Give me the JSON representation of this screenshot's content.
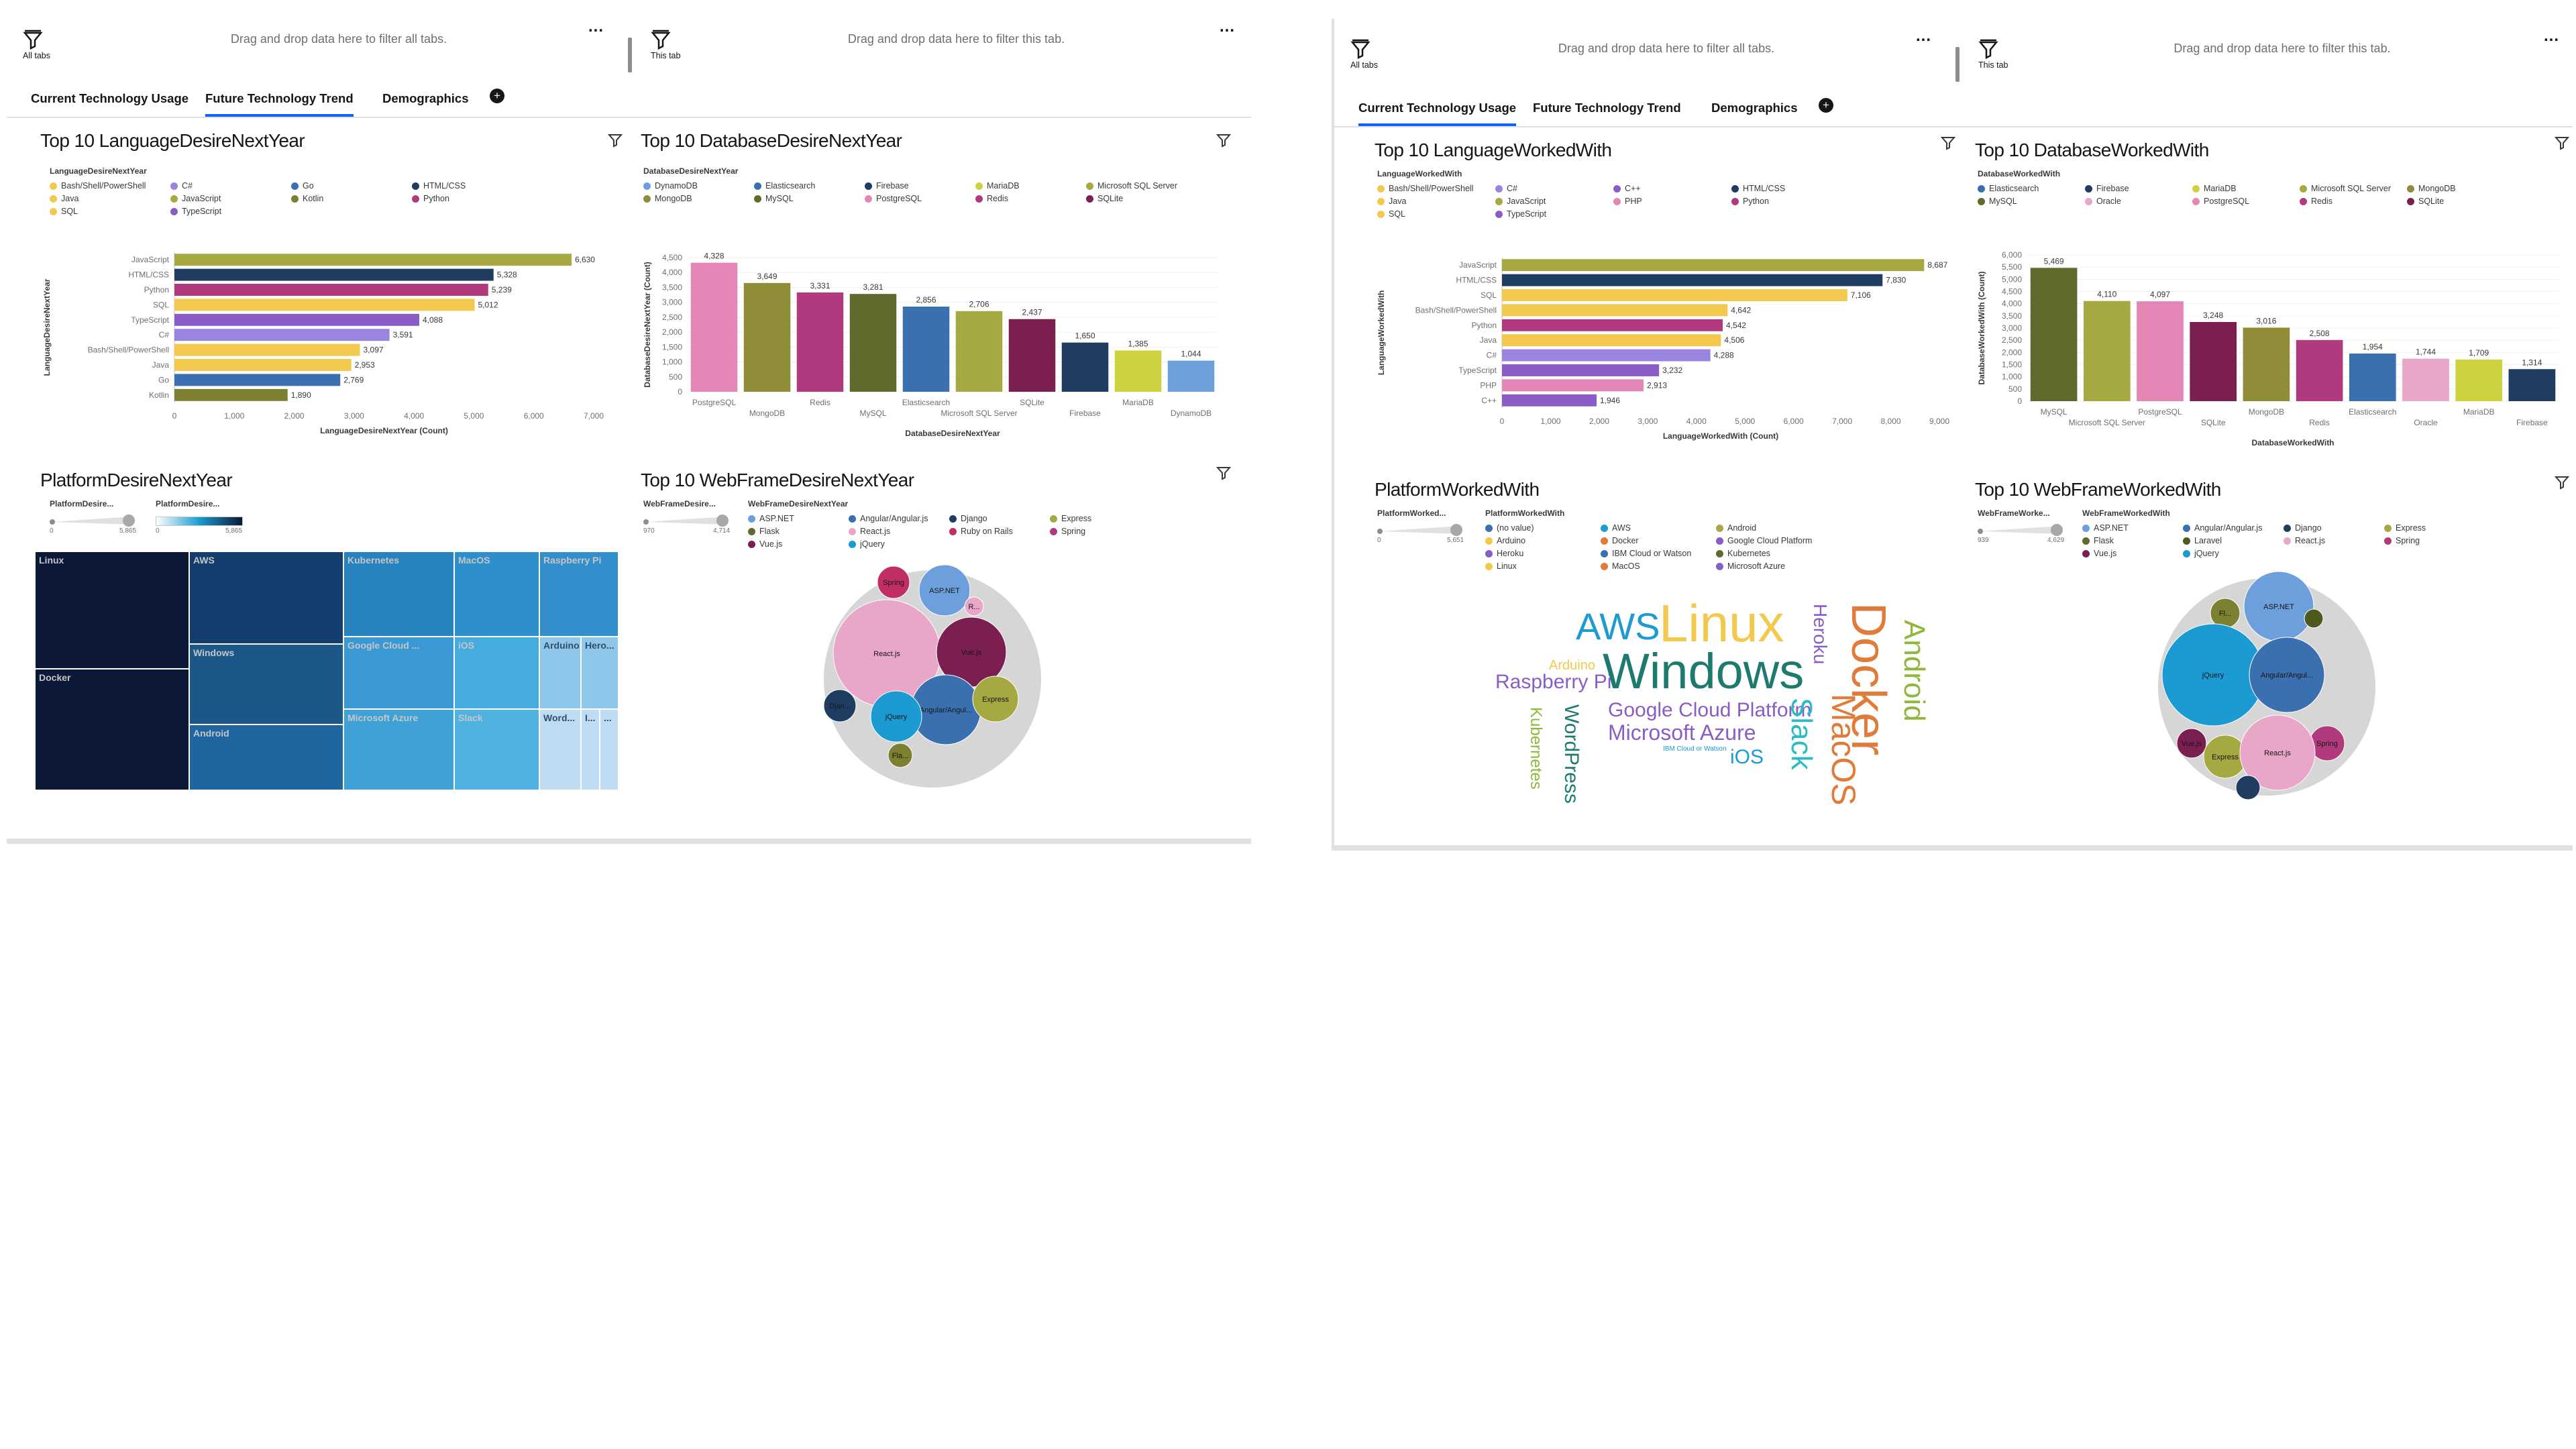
{
  "colors": {
    "olive": "#a6a841",
    "navy": "#1f3d60",
    "magenta": "#b03a7d",
    "yellow": "#f2c94c",
    "purple": "#8a5cc6",
    "lavender": "#9b84e0",
    "blue": "#3a6fb0",
    "pink": "#e486b6",
    "darkolive": "#5f6b2d",
    "olive2": "#8f8d38",
    "wine": "#7a1f4f",
    "lightblue": "#6e9fdd",
    "lime": "#cdd33e",
    "teal": "#1b9bd1",
    "red": "#c02e63",
    "darkgreen": "#4c5a1e"
  },
  "left": {
    "dropzone_all": {
      "label": "All tabs",
      "text": "Drag and drop data here to filter all tabs.",
      "more": "..."
    },
    "dropzone_tab": {
      "label": "This tab",
      "text": "Drag and drop data here to filter this tab.",
      "more": "..."
    },
    "tabs": [
      "Current Technology Usage",
      "Future Technology Trend",
      "Demographics"
    ],
    "active_tab": 1,
    "add_tab": "+",
    "lang": {
      "title": "Top 10 LanguageDesireNextYear",
      "legend_title": "LanguageDesireNextYear",
      "legend": [
        {
          "label": "Bash/Shell/PowerShell",
          "color": "#f2c94c"
        },
        {
          "label": "C#",
          "color": "#9b84e0"
        },
        {
          "label": "Go",
          "color": "#3a6fb0"
        },
        {
          "label": "HTML/CSS",
          "color": "#1f3d60"
        },
        {
          "label": "Java",
          "color": "#f2c94c"
        },
        {
          "label": "JavaScript",
          "color": "#a6a841"
        },
        {
          "label": "Kotlin",
          "color": "#7c8030"
        },
        {
          "label": "Python",
          "color": "#b03a7d"
        },
        {
          "label": "SQL",
          "color": "#f2c94c"
        },
        {
          "label": "TypeScript",
          "color": "#8a5cc6"
        }
      ]
    },
    "db": {
      "title": "Top 10 DatabaseDesireNextYear",
      "legend_title": "DatabaseDesireNextYear",
      "legend": [
        {
          "label": "DynamoDB",
          "color": "#6e9fdd"
        },
        {
          "label": "Elasticsearch",
          "color": "#3a6fb0"
        },
        {
          "label": "Firebase",
          "color": "#1f3d60"
        },
        {
          "label": "MariaDB",
          "color": "#cdd33e"
        },
        {
          "label": "Microsoft SQL Server",
          "color": "#a6a841"
        },
        {
          "label": "MongoDB",
          "color": "#8f8d38"
        },
        {
          "label": "MySQL",
          "color": "#5f6b2d"
        },
        {
          "label": "PostgreSQL",
          "color": "#e486b6"
        },
        {
          "label": "Redis",
          "color": "#b03a7d"
        },
        {
          "label": "SQLite",
          "color": "#7a1f4f"
        }
      ]
    },
    "platform": {
      "title": "PlatformDesireNextYear",
      "legend_title_a": "PlatformDesire...",
      "legend_title_b": "PlatformDesire...",
      "slider_min": "0",
      "slider_max": "5,865",
      "grad_min": "0",
      "grad_max": "5,865"
    },
    "web": {
      "title": "Top 10 WebFrameDesireNextYear",
      "legend_title_a": "WebFrameDesire...",
      "legend_title_b": "WebFrameDesireNextYear",
      "slider_min": "970",
      "slider_max": "4,714",
      "legend": [
        {
          "label": "ASP.NET",
          "color": "#6e9fdd"
        },
        {
          "label": "Angular/Angular.js",
          "color": "#3a6fb0"
        },
        {
          "label": "Django",
          "color": "#1f3d60"
        },
        {
          "label": "Express",
          "color": "#a6a841"
        },
        {
          "label": "Flask",
          "color": "#5f6b2d"
        },
        {
          "label": "React.js",
          "color": "#e8a6c8"
        },
        {
          "label": "Ruby on Rails",
          "color": "#c02e63"
        },
        {
          "label": "Spring",
          "color": "#b03a7d"
        },
        {
          "label": "Vue.js",
          "color": "#7a1f4f"
        },
        {
          "label": "jQuery",
          "color": "#1b9bd1"
        }
      ]
    }
  },
  "right": {
    "dropzone_all": {
      "label": "All tabs",
      "text": "Drag and drop data here to filter all tabs.",
      "more": "..."
    },
    "dropzone_tab": {
      "label": "This tab",
      "text": "Drag and drop data here to filter this tab.",
      "more": "..."
    },
    "tabs": [
      "Current Technology Usage",
      "Future Technology Trend",
      "Demographics"
    ],
    "active_tab": 0,
    "add_tab": "+",
    "lang": {
      "title": "Top 10 LanguageWorkedWith",
      "legend_title": "LanguageWorkedWith",
      "legend": [
        {
          "label": "Bash/Shell/PowerShell",
          "color": "#f2c94c"
        },
        {
          "label": "C#",
          "color": "#9b84e0"
        },
        {
          "label": "C++",
          "color": "#8a5cc6"
        },
        {
          "label": "HTML/CSS",
          "color": "#1f3d60"
        },
        {
          "label": "Java",
          "color": "#f2c94c"
        },
        {
          "label": "JavaScript",
          "color": "#a6a841"
        },
        {
          "label": "PHP",
          "color": "#e486b6"
        },
        {
          "label": "Python",
          "color": "#b03a7d"
        },
        {
          "label": "SQL",
          "color": "#f2c94c"
        },
        {
          "label": "TypeScript",
          "color": "#8a5cc6"
        }
      ]
    },
    "db": {
      "title": "Top 10 DatabaseWorkedWith",
      "legend_title": "DatabaseWorkedWith",
      "legend": [
        {
          "label": "Elasticsearch",
          "color": "#3a6fb0"
        },
        {
          "label": "Firebase",
          "color": "#1f3d60"
        },
        {
          "label": "MariaDB",
          "color": "#cdd33e"
        },
        {
          "label": "Microsoft SQL Server",
          "color": "#a6a841"
        },
        {
          "label": "MongoDB",
          "color": "#8f8d38"
        },
        {
          "label": "MySQL",
          "color": "#5f6b2d"
        },
        {
          "label": "Oracle",
          "color": "#e8a6c8"
        },
        {
          "label": "PostgreSQL",
          "color": "#e486b6"
        },
        {
          "label": "Redis",
          "color": "#b03a7d"
        },
        {
          "label": "SQLite",
          "color": "#7a1f4f"
        }
      ]
    },
    "platform": {
      "title": "PlatformWorkedWith",
      "legend_title_a": "PlatformWorked...",
      "legend_title_b": "PlatformWorkedWith",
      "slider_min": "0",
      "slider_max": "5,651",
      "legend": [
        {
          "label": "(no value)",
          "color": "#3a6fb0"
        },
        {
          "label": "AWS",
          "color": "#1b9bd1"
        },
        {
          "label": "Android",
          "color": "#a6a841"
        },
        {
          "label": "Arduino",
          "color": "#f2c94c"
        },
        {
          "label": "Docker",
          "color": "#e07b39"
        },
        {
          "label": "Google Cloud Platform",
          "color": "#8a5cc6"
        },
        {
          "label": "Heroku",
          "color": "#8a5cc6"
        },
        {
          "label": "IBM Cloud or Watson",
          "color": "#3a6fb0"
        },
        {
          "label": "Kubernetes",
          "color": "#5f6b2d"
        },
        {
          "label": "Linux",
          "color": "#f2c94c"
        },
        {
          "label": "MacOS",
          "color": "#e07b39"
        },
        {
          "label": "Microsoft Azure",
          "color": "#8a5cc6"
        }
      ]
    },
    "wordcloud": [
      {
        "text": "AWS",
        "color": "#1b9bd1"
      },
      {
        "text": "Linux",
        "color": "#f2c94c"
      },
      {
        "text": "Heroku",
        "color": "#8a5cc6"
      },
      {
        "text": "Docker",
        "color": "#e07b39"
      },
      {
        "text": "Android",
        "color": "#8fb83a"
      },
      {
        "text": "Arduino",
        "color": "#f2c94c"
      },
      {
        "text": "Raspberry Pi",
        "color": "#8a5cc6"
      },
      {
        "text": "Windows",
        "color": "#1c7a6e"
      },
      {
        "text": "Google Cloud Platform",
        "color": "#8a5cc6"
      },
      {
        "text": "Microsoft Azure",
        "color": "#8a5cc6"
      },
      {
        "text": "IBM Cloud or Watson",
        "color": "#1b9bd1"
      },
      {
        "text": "iOS",
        "color": "#1b9bd1"
      },
      {
        "text": "Slack",
        "color": "#2bbbc4"
      },
      {
        "text": "MacOS",
        "color": "#e07b39"
      },
      {
        "text": "Kubernetes",
        "color": "#8fb83a"
      },
      {
        "text": "WordPress",
        "color": "#1c7a6e"
      }
    ],
    "web": {
      "title": "Top 10 WebFrameWorkedWith",
      "legend_title_a": "WebFrameWorke...",
      "legend_title_b": "WebFrameWorkedWith",
      "slider_min": "939",
      "slider_max": "4,629",
      "legend": [
        {
          "label": "ASP.NET",
          "color": "#6e9fdd"
        },
        {
          "label": "Angular/Angular.js",
          "color": "#3a6fb0"
        },
        {
          "label": "Django",
          "color": "#1f3d60"
        },
        {
          "label": "Express",
          "color": "#a6a841"
        },
        {
          "label": "Flask",
          "color": "#5f6b2d"
        },
        {
          "label": "Laravel",
          "color": "#4c5a1e"
        },
        {
          "label": "React.js",
          "color": "#e8a6c8"
        },
        {
          "label": "Spring",
          "color": "#b03a7d"
        },
        {
          "label": "Vue.js",
          "color": "#7a1f4f"
        },
        {
          "label": "jQuery",
          "color": "#1b9bd1"
        }
      ]
    }
  },
  "chart_data": [
    {
      "id": "left-lang",
      "type": "bar",
      "orientation": "horizontal",
      "title": "Top 10 LanguageDesireNextYear",
      "xlabel": "LanguageDesireNextYear (Count)",
      "ylabel": "LanguageDesireNextYear",
      "categories": [
        "JavaScript",
        "HTML/CSS",
        "Python",
        "SQL",
        "TypeScript",
        "C#",
        "Bash/Shell/PowerShell",
        "Java",
        "Go",
        "Kotlin"
      ],
      "values": [
        6630,
        5328,
        5239,
        5012,
        4088,
        3591,
        3097,
        2953,
        2769,
        1890
      ],
      "value_labels": [
        "6,630",
        "5,328",
        "5,239",
        "5,012",
        "4,088",
        "3,591",
        "3,097",
        "2,953",
        "2,769",
        "1,890"
      ],
      "colors": [
        "#a6a841",
        "#1f3d60",
        "#b03a7d",
        "#f2c94c",
        "#8a5cc6",
        "#9b84e0",
        "#f2c94c",
        "#f2c94c",
        "#3a6fb0",
        "#7c8030"
      ],
      "ticks": [
        "0",
        "1,000",
        "2,000",
        "3,000",
        "4,000",
        "5,000",
        "6,000",
        "7,000"
      ],
      "xlim": [
        0,
        7000
      ]
    },
    {
      "id": "left-db",
      "type": "bar",
      "title": "Top 10 DatabaseDesireNextYear",
      "xlabel": "DatabaseDesireNextYear",
      "ylabel": "DatabaseDesireNextYear (Count)",
      "categories": [
        "PostgreSQL",
        "MongoDB",
        "Redis",
        "MySQL",
        "Elasticsearch",
        "Microsoft SQL Server",
        "SQLite",
        "Firebase",
        "MariaDB",
        "DynamoDB"
      ],
      "values": [
        4328,
        3649,
        3331,
        3281,
        2856,
        2706,
        2437,
        1650,
        1385,
        1044
      ],
      "value_labels": [
        "4,328",
        "3,649",
        "3,331",
        "3,281",
        "2,856",
        "2,706",
        "2,437",
        "1,650",
        "1,385",
        "1,044"
      ],
      "colors": [
        "#e486b6",
        "#8f8d38",
        "#b03a7d",
        "#5f6b2d",
        "#3a6fb0",
        "#a6a841",
        "#7a1f4f",
        "#1f3d60",
        "#cdd33e",
        "#6e9fdd"
      ],
      "ticks": [
        "0",
        "500",
        "1,000",
        "1,500",
        "2,000",
        "2,500",
        "3,000",
        "3,500",
        "4,000",
        "4,500"
      ],
      "ylim": [
        0,
        4500
      ]
    },
    {
      "id": "right-lang",
      "type": "bar",
      "orientation": "horizontal",
      "title": "Top 10 LanguageWorkedWith",
      "xlabel": "LanguageWorkedWith (Count)",
      "ylabel": "LanguageWorkedWith",
      "categories": [
        "JavaScript",
        "HTML/CSS",
        "SQL",
        "Bash/Shell/PowerShell",
        "Python",
        "Java",
        "C#",
        "TypeScript",
        "PHP",
        "C++"
      ],
      "values": [
        8687,
        7830,
        7106,
        4642,
        4542,
        4506,
        4288,
        3232,
        2913,
        1946
      ],
      "value_labels": [
        "8,687",
        "7,830",
        "7,106",
        "4,642",
        "4,542",
        "4,506",
        "4,288",
        "3,232",
        "2,913",
        "1,946"
      ],
      "colors": [
        "#a6a841",
        "#1f3d60",
        "#f2c94c",
        "#f2c94c",
        "#b03a7d",
        "#f2c94c",
        "#9b84e0",
        "#8a5cc6",
        "#e486b6",
        "#8a5cc6"
      ],
      "ticks": [
        "0",
        "1,000",
        "2,000",
        "3,000",
        "4,000",
        "5,000",
        "6,000",
        "7,000",
        "8,000",
        "9,000"
      ],
      "xlim": [
        0,
        9000
      ]
    },
    {
      "id": "right-db",
      "type": "bar",
      "title": "Top 10 DatabaseWorkedWith",
      "xlabel": "DatabaseWorkedWith",
      "ylabel": "DatabaseWorkedWith (Count)",
      "categories": [
        "MySQL",
        "Microsoft SQL Server",
        "PostgreSQL",
        "SQLite",
        "MongoDB",
        "Redis",
        "Elasticsearch",
        "Oracle",
        "MariaDB",
        "Firebase"
      ],
      "values": [
        5469,
        4110,
        4097,
        3248,
        3016,
        2508,
        1954,
        1744,
        1709,
        1314
      ],
      "value_labels": [
        "5,469",
        "4,110",
        "4,097",
        "3,248",
        "3,016",
        "2,508",
        "1,954",
        "1,744",
        "1,709",
        "1,314"
      ],
      "colors": [
        "#5f6b2d",
        "#a6a841",
        "#e486b6",
        "#7a1f4f",
        "#8f8d38",
        "#b03a7d",
        "#3a6fb0",
        "#e8a6c8",
        "#cdd33e",
        "#1f3d60"
      ],
      "ticks": [
        "0",
        "500",
        "1,000",
        "1,500",
        "2,000",
        "2,500",
        "3,000",
        "3,500",
        "4,000",
        "4,500",
        "5,000",
        "5,500",
        "6,000"
      ],
      "ylim": [
        0,
        6000
      ]
    },
    {
      "id": "left-treemap",
      "type": "heatmap",
      "title": "PlatformDesireNextYear",
      "labels": [
        "Linux",
        "Docker",
        "AWS",
        "Windows",
        "Android",
        "Kubernetes",
        "MacOS",
        "Raspberry Pi",
        "Google Cloud ...",
        "Microsoft Azure",
        "iOS",
        "Slack",
        "Arduino",
        "Hero...",
        "Word...",
        "I...",
        "..."
      ],
      "colors": [
        "#0c1838",
        "#0c1838",
        "#123d6c",
        "#1b5788",
        "#1f66a0",
        "#2782bd",
        "#2d8fcb",
        "#338fcc",
        "#3a99d2",
        "#3fa2d7",
        "#46acdd",
        "#4eb3e1",
        "#8fc7ea",
        "#8fc7ea",
        "#bfdcf2",
        "#bfdcf2",
        "#bfdcf2"
      ]
    },
    {
      "id": "left-bubbles",
      "type": "scatter",
      "title": "Top 10 WebFrameDesireNextYear",
      "bubbles": [
        {
          "label": "Spring",
          "color": "#c02e63"
        },
        {
          "label": "ASP.NET",
          "color": "#6e9fdd"
        },
        {
          "label": "R...",
          "color": "#e8a6c8"
        },
        {
          "label": "React.js",
          "color": "#e8a6c8"
        },
        {
          "label": "Vue.js",
          "color": "#7a1f4f"
        },
        {
          "label": "Djan...",
          "color": "#1f3d60"
        },
        {
          "label": "Angular/Angul...",
          "color": "#3a6fb0"
        },
        {
          "label": "Express",
          "color": "#a6a841"
        },
        {
          "label": "jQuery",
          "color": "#1b9bd1"
        },
        {
          "label": "Fla...",
          "color": "#7c8030"
        }
      ]
    },
    {
      "id": "right-bubbles",
      "type": "scatter",
      "title": "Top 10 WebFrameWorkedWith",
      "bubbles": [
        {
          "label": "Fl...",
          "color": "#7c8030"
        },
        {
          "label": "ASP.NET",
          "color": "#6e9fdd"
        },
        {
          "label": "",
          "color": "#4c5a1e"
        },
        {
          "label": "jQuery",
          "color": "#1b9bd1"
        },
        {
          "label": "Angular/Angul...",
          "color": "#3a6fb0"
        },
        {
          "label": "Vue.js",
          "color": "#7a1f4f"
        },
        {
          "label": "Spring",
          "color": "#b03a7d"
        },
        {
          "label": "Express",
          "color": "#a6a841"
        },
        {
          "label": "React.js",
          "color": "#e8a6c8"
        },
        {
          "label": "",
          "color": "#1f3d60"
        }
      ]
    }
  ]
}
